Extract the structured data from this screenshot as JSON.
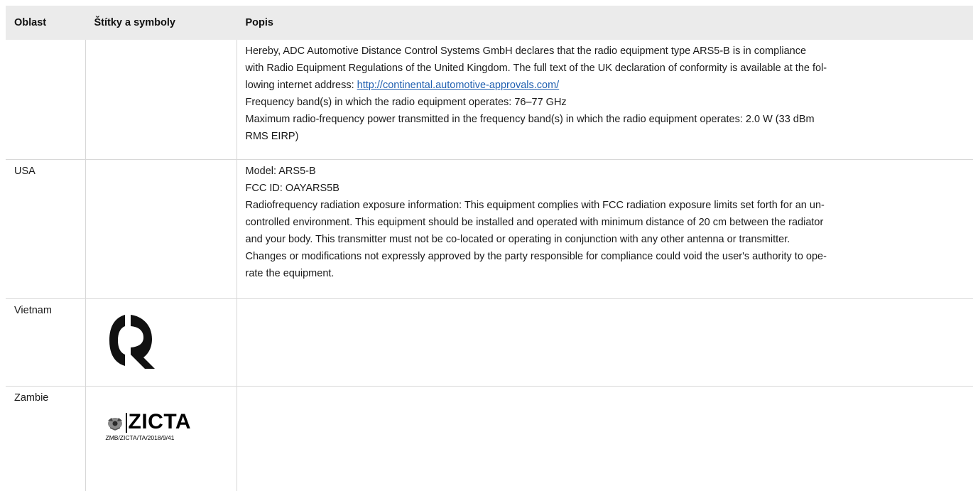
{
  "table": {
    "headers": {
      "region": "Oblast",
      "labels": "Štítky a symboly",
      "description": "Popis"
    },
    "rows": [
      {
        "region": "",
        "description_lines": [
          "Hereby, ADC Automotive Distance Control Systems GmbH declares that the radio equipment type ARS5-B is in compliance",
          "with Radio Equipment Regulations of the United Kingdom. The full text of the UK declaration of conformity is available at the fol-",
          "lowing internet address: ",
          "Frequency band(s) in which the radio equipment operates: 76–77 GHz",
          "Maximum radio-frequency power transmitted in the frequency band(s) in which the radio equipment operates: 2.0 W (33 dBm",
          "RMS EIRP)"
        ],
        "link": "http://continental.automotive-approvals.com/"
      },
      {
        "region": "USA",
        "description_lines": [
          "Model: ARS5-B",
          "FCC ID: OAYARS5B",
          "Radiofrequency radiation exposure information: This equipment complies with FCC radiation exposure limits set forth for an un-",
          "controlled environment. This equipment should be installed and operated with minimum distance of 20 cm between the radiator",
          "and your body. This transmitter must not be co-located or operating in conjunction with any other antenna or transmitter.",
          "Changes or modifications not expressly approved by the party responsible for compliance could void the user's authority to ope-",
          "rate the equipment."
        ]
      },
      {
        "region": "Vietnam",
        "symbol": "vietnam-cr-conformity-mark"
      },
      {
        "region": "Zambie",
        "symbol": "zicta-logo",
        "logo_text": "ZICTA",
        "logo_code": "ZMB/ZICTA/TA/2018/9/41"
      }
    ]
  }
}
